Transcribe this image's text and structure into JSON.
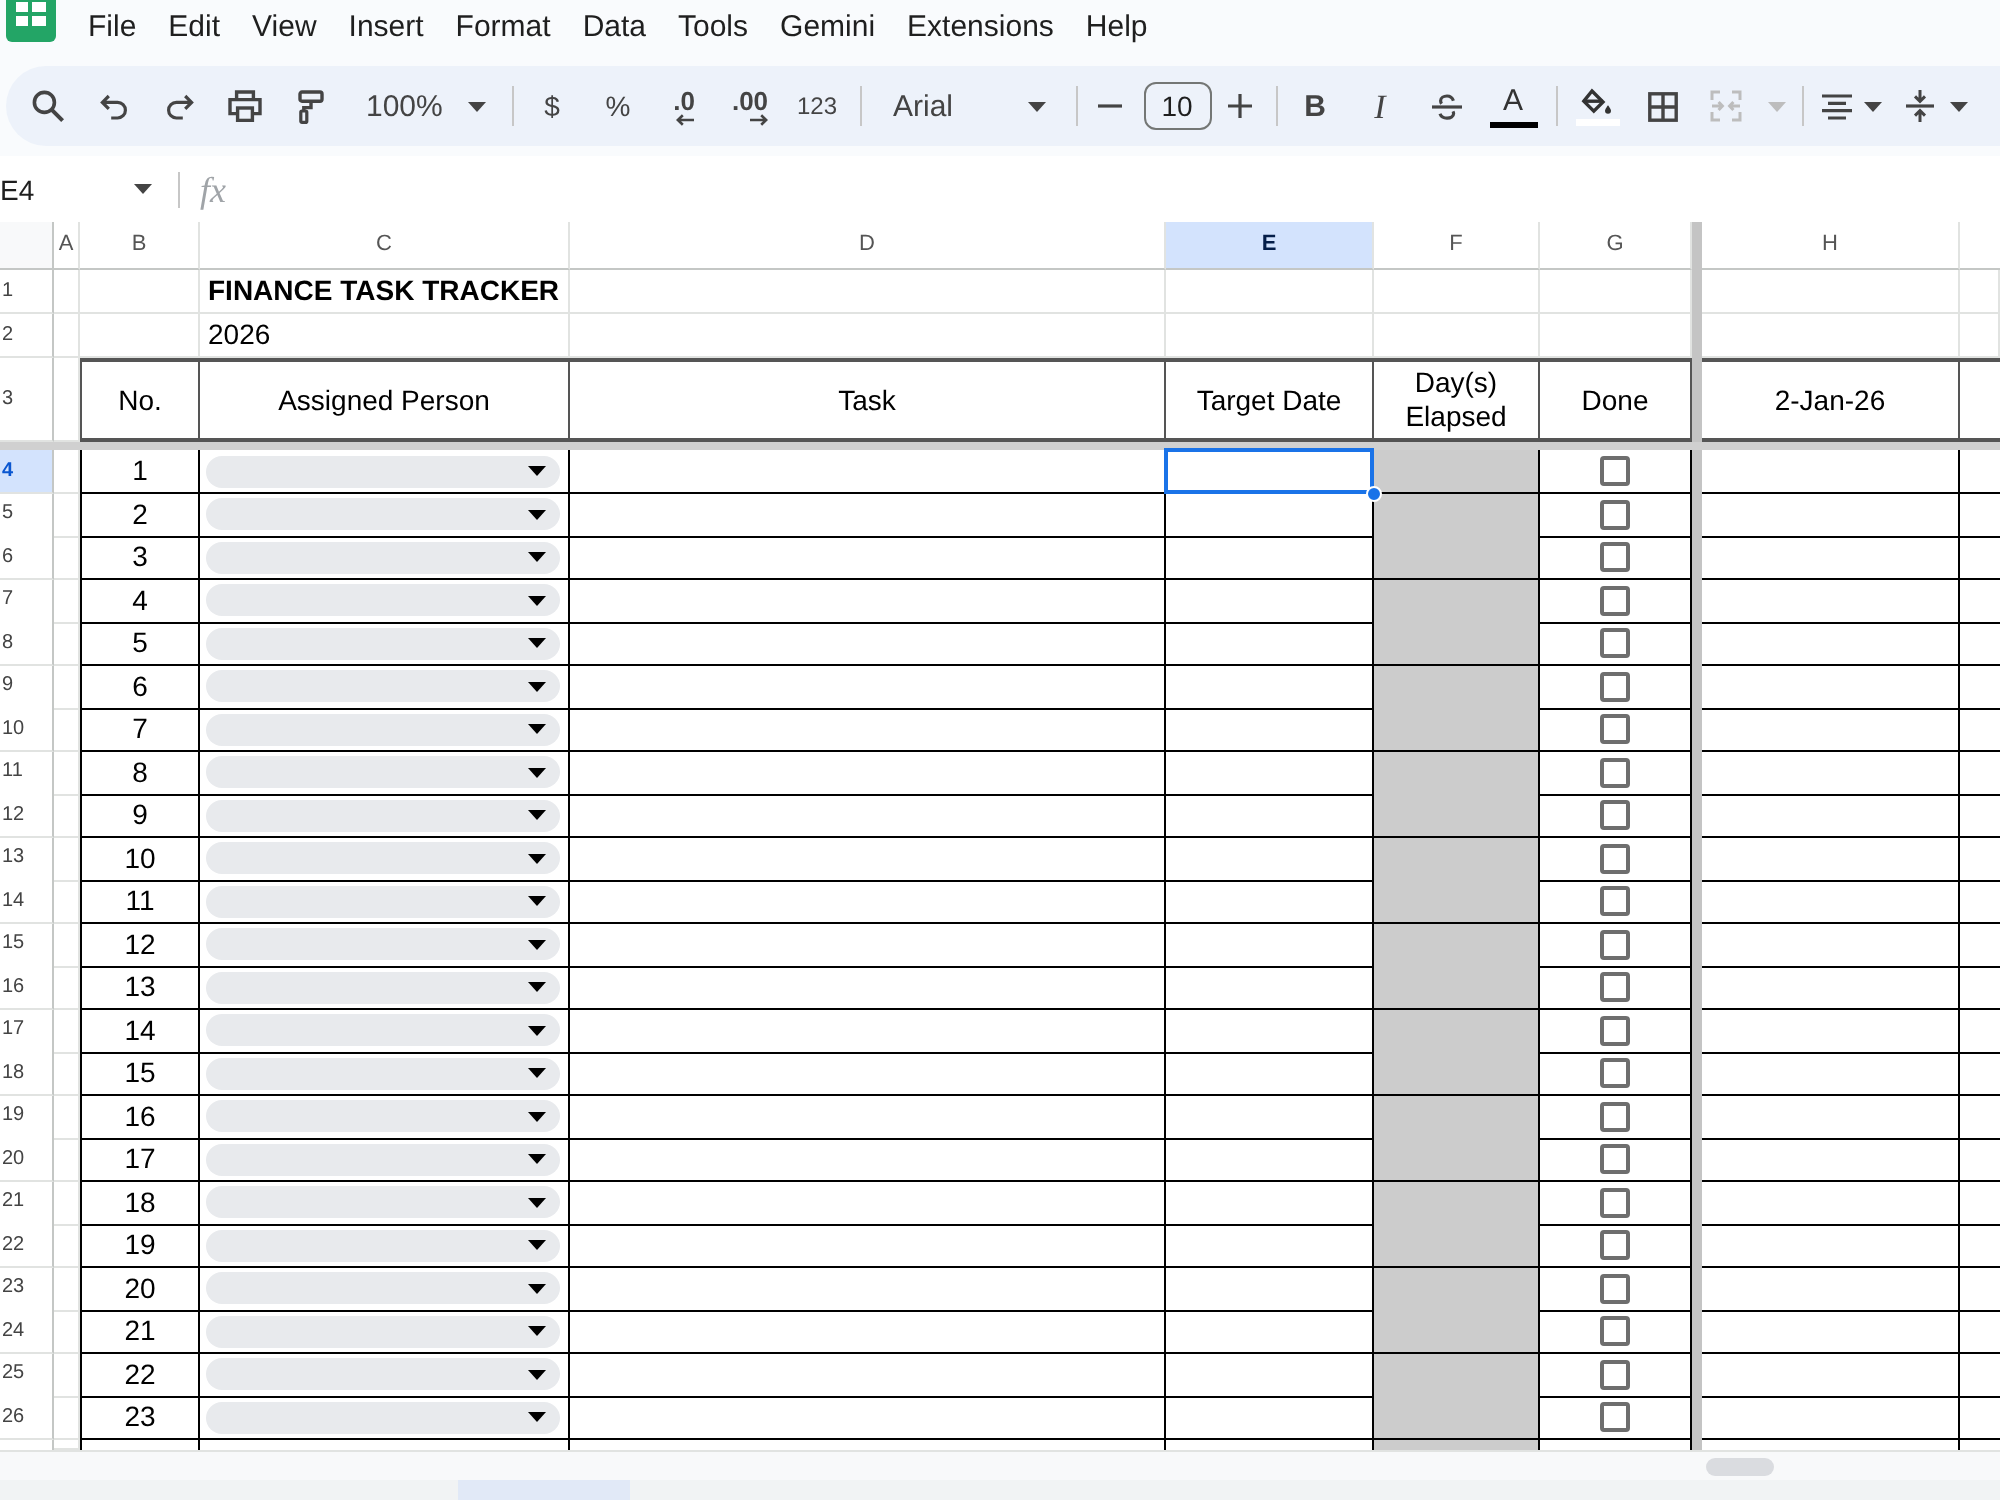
{
  "menu": [
    "File",
    "Edit",
    "View",
    "Insert",
    "Format",
    "Data",
    "Tools",
    "Gemini",
    "Extensions",
    "Help"
  ],
  "toolbar": {
    "zoom": "100%",
    "currency": "$",
    "percent": "%",
    "decimal_decrease": ".0",
    "decimal_increase": ".00",
    "number_format": "123",
    "font": "Arial",
    "font_size": "10",
    "bold": "B",
    "italic": "I",
    "text_color": "A",
    "merge": {
      "disabled": true
    }
  },
  "formula_bar": {
    "name_box": "E4",
    "function_label": "fx"
  },
  "sheet": {
    "columns": [
      {
        "label": "A",
        "selected": false
      },
      {
        "label": "B",
        "selected": false
      },
      {
        "label": "C",
        "selected": false
      },
      {
        "label": "D",
        "selected": false
      },
      {
        "label": "E",
        "selected": true
      },
      {
        "label": "F",
        "selected": false
      },
      {
        "label": "G",
        "selected": false
      },
      {
        "label": "H",
        "selected": false
      }
    ],
    "rows": [
      {
        "label": "1",
        "selected": false
      },
      {
        "label": "2",
        "selected": false
      },
      {
        "label": "3",
        "selected": false
      },
      {
        "label": "4",
        "selected": true
      },
      {
        "label": "5",
        "selected": false
      },
      {
        "label": "6",
        "selected": false
      },
      {
        "label": "7",
        "selected": false
      },
      {
        "label": "8",
        "selected": false
      },
      {
        "label": "9",
        "selected": false
      },
      {
        "label": "10",
        "selected": false
      },
      {
        "label": "11",
        "selected": false
      },
      {
        "label": "12",
        "selected": false
      },
      {
        "label": "13",
        "selected": false
      },
      {
        "label": "14",
        "selected": false
      },
      {
        "label": "15",
        "selected": false
      },
      {
        "label": "16",
        "selected": false
      },
      {
        "label": "17",
        "selected": false
      },
      {
        "label": "18",
        "selected": false
      },
      {
        "label": "19",
        "selected": false
      },
      {
        "label": "20",
        "selected": false
      },
      {
        "label": "21",
        "selected": false
      },
      {
        "label": "22",
        "selected": false
      },
      {
        "label": "23",
        "selected": false
      },
      {
        "label": "24",
        "selected": false
      },
      {
        "label": "25",
        "selected": false
      },
      {
        "label": "26",
        "selected": false
      }
    ],
    "title": "FINANCE TASK TRACKER",
    "year": "2026",
    "table": {
      "columns": [
        {
          "label": "No.",
          "kind": "number"
        },
        {
          "label": "Assigned Person",
          "kind": "dropdown"
        },
        {
          "label": "Task",
          "kind": "text"
        },
        {
          "label": "Target Date",
          "kind": "text"
        },
        {
          "label": "Day(s) Elapsed",
          "kind": "shaded"
        },
        {
          "label": "Done",
          "kind": "checkbox"
        },
        {
          "label": "2-Jan-26",
          "kind": "text"
        }
      ],
      "rows": [
        {
          "no": "1",
          "done": false
        },
        {
          "no": "2",
          "done": false
        },
        {
          "no": "3",
          "done": false
        },
        {
          "no": "4",
          "done": false
        },
        {
          "no": "5",
          "done": false
        },
        {
          "no": "6",
          "done": false
        },
        {
          "no": "7",
          "done": false
        },
        {
          "no": "8",
          "done": false
        },
        {
          "no": "9",
          "done": false
        },
        {
          "no": "10",
          "done": false
        },
        {
          "no": "11",
          "done": false
        },
        {
          "no": "12",
          "done": false
        },
        {
          "no": "13",
          "done": false
        },
        {
          "no": "14",
          "done": false
        },
        {
          "no": "15",
          "done": false
        },
        {
          "no": "16",
          "done": false
        },
        {
          "no": "17",
          "done": false
        },
        {
          "no": "18",
          "done": false
        },
        {
          "no": "19",
          "done": false
        },
        {
          "no": "20",
          "done": false
        },
        {
          "no": "21",
          "done": false
        },
        {
          "no": "22",
          "done": false
        },
        {
          "no": "23",
          "done": false
        }
      ]
    }
  }
}
